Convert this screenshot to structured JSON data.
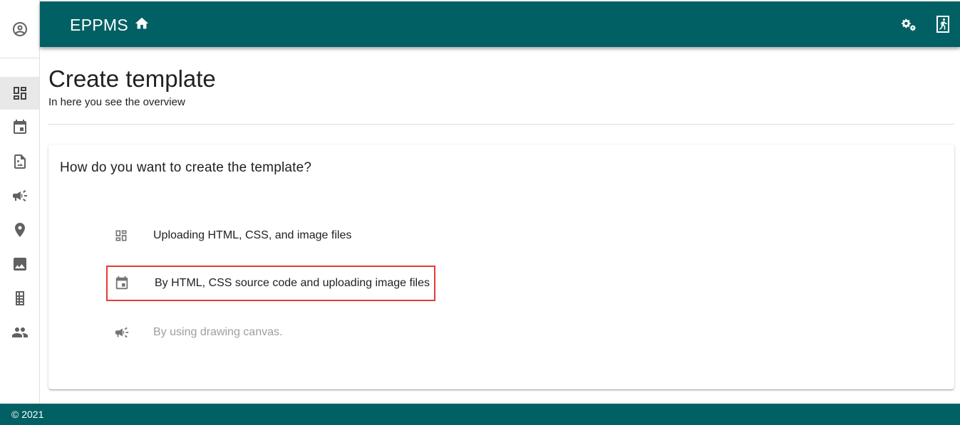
{
  "header": {
    "title": "EPPMS",
    "icons": [
      "home-icon",
      "settings-icon",
      "logout-icon"
    ]
  },
  "sidebar": {
    "account_icon": "account-circle-icon",
    "items": [
      {
        "icon": "dashboard-icon",
        "active": true
      },
      {
        "icon": "calendar-icon",
        "active": false
      },
      {
        "icon": "image-file-icon",
        "active": false
      },
      {
        "icon": "megaphone-icon",
        "active": false
      },
      {
        "icon": "location-pin-icon",
        "active": false
      },
      {
        "icon": "image-icon",
        "active": false
      },
      {
        "icon": "building-icon",
        "active": false
      },
      {
        "icon": "people-icon",
        "active": false
      }
    ]
  },
  "page": {
    "title": "Create template",
    "subtitle": "In here you see the overview"
  },
  "card": {
    "title": "How do you want to create the template?",
    "options": [
      {
        "icon": "dashboard-icon",
        "label": "Uploading HTML, CSS, and image files",
        "disabled": false,
        "highlighted": false
      },
      {
        "icon": "calendar-icon",
        "label": "By HTML, CSS source code and uploading image files",
        "disabled": false,
        "highlighted": true
      },
      {
        "icon": "megaphone-icon",
        "label": "By using drawing canvas.",
        "disabled": true,
        "highlighted": false
      }
    ]
  },
  "footer": {
    "text": "© 2021"
  },
  "colors": {
    "primary": "#006064",
    "highlight_border": "#e53935",
    "disabled_text": "#9e9e9e",
    "icon_gray": "#616161"
  }
}
